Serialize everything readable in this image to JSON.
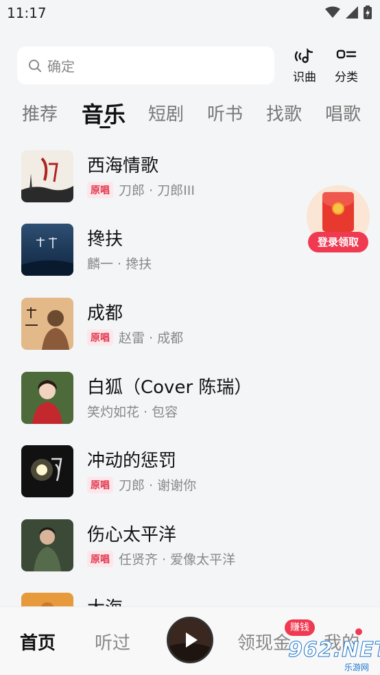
{
  "status_bar": {
    "time": "11:17"
  },
  "search": {
    "placeholder": "确定"
  },
  "top_actions": {
    "recognize_label": "识曲",
    "category_label": "分类"
  },
  "tabs": [
    {
      "label": "推荐"
    },
    {
      "label": "音乐",
      "active": true
    },
    {
      "label": "短剧"
    },
    {
      "label": "听书"
    },
    {
      "label": "找歌"
    },
    {
      "label": "唱歌"
    }
  ],
  "songs": [
    {
      "title": "西海情歌",
      "badge": "原唱",
      "subtitle": "刀郎 · 刀郎III"
    },
    {
      "title": "搀扶",
      "badge": "",
      "subtitle": "麟一 · 搀扶"
    },
    {
      "title": "成都",
      "badge": "原唱",
      "subtitle": "赵雷 · 成都"
    },
    {
      "title": "白狐（Cover 陈瑞）",
      "badge": "",
      "subtitle": "笑灼如花 · 包容"
    },
    {
      "title": "冲动的惩罚",
      "badge": "原唱",
      "subtitle": "刀郎 · 谢谢你"
    },
    {
      "title": "伤心太平洋",
      "badge": "原唱",
      "subtitle": "任贤齐 · 爱像太平洋"
    },
    {
      "title": "大海",
      "badge": "",
      "subtitle": ""
    }
  ],
  "promo": {
    "label": "登录领取"
  },
  "bottom_nav": {
    "home": "首页",
    "listened": "听过",
    "cash": "领现金",
    "earn_badge": "赚钱",
    "mine": "我的"
  },
  "watermark": {
    "main": "962.NET",
    "sub": "乐游网"
  },
  "colors": {
    "accent_red": "#ef3a52",
    "badge_red": "#e0364c",
    "background": "#f4f5f7"
  }
}
